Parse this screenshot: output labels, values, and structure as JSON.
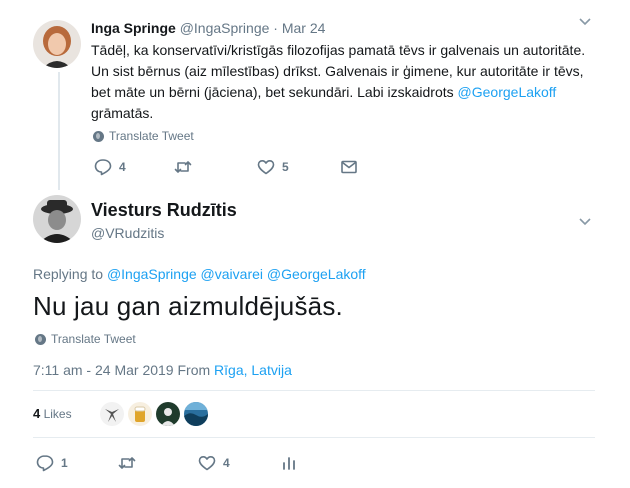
{
  "parent_tweet": {
    "name": "Inga Springe",
    "handle": "@IngaSpringe",
    "separator": "·",
    "date": "Mar 24",
    "text_lines": [
      "Tādēļ, ka konservatīvi/kristīgās filozofijas pamatā tēvs ir galvenais un autoritāte.",
      "Un sist bērnus (aiz mīlestības) drīkst. Galvenais ir ģimene, kur autoritāte ir tēvs,",
      "bet māte un bērni (jāciena), bet sekundāri. Labi izskaidrots "
    ],
    "mention": "@GeorgeLakoff",
    "text_end": "grāmatās.",
    "translate": "Translate Tweet",
    "replies": "4",
    "likes": "5"
  },
  "main_tweet": {
    "name": "Viesturs Rudzītis",
    "handle": "@VRudzitis",
    "replying_prefix": "Replying to",
    "replying_to": [
      "@IngaSpringe",
      "@vaivarei",
      "@GeorgeLakoff"
    ],
    "text": "Nu jau gan aizmuldējušās.",
    "translate": "Translate Tweet",
    "time_date": "7:11 am - 24 Mar 2019 From",
    "location": "Rīga, Latvija",
    "likes_count": "4",
    "likes_label": "Likes",
    "replies": "1",
    "likes": "4"
  },
  "icons": {
    "reply": "reply-icon",
    "retweet": "retweet-icon",
    "like": "heart-icon",
    "dm": "envelope-icon",
    "analytics": "analytics-icon",
    "more": "chevron-down-icon",
    "translate": "globe-icon"
  },
  "colors": {
    "link": "#1da1f2",
    "muted": "#657786",
    "text": "#14171a"
  }
}
